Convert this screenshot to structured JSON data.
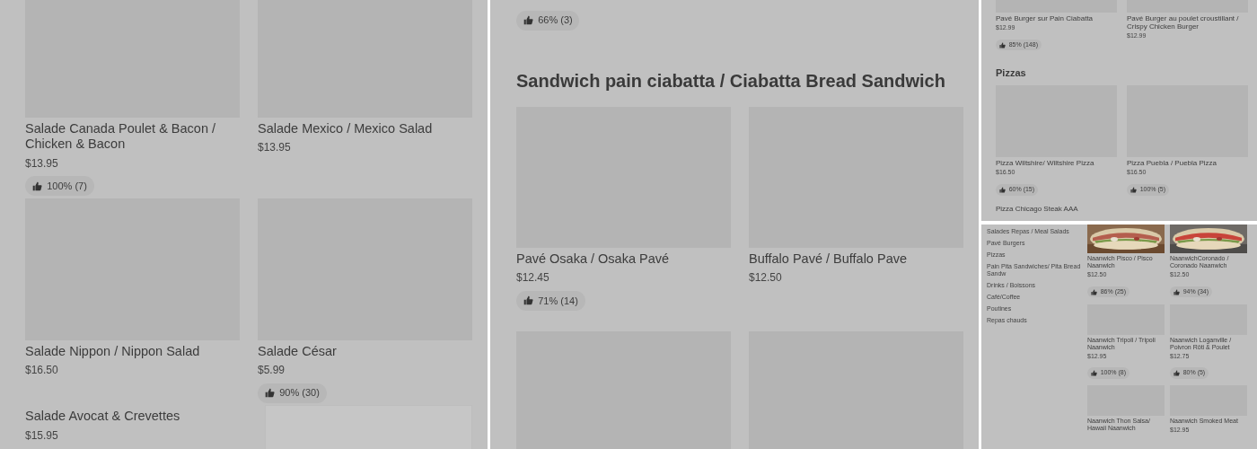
{
  "panels": [
    {
      "kind": "menu",
      "sections": [
        {
          "items": [
            {
              "name": "Salade Canada Poulet & Bacon / Chicken & Bacon",
              "price": "$13.95",
              "rating": "100% (7)",
              "kind": "placeholder"
            },
            {
              "name": "Salade Mexico / Mexico Salad",
              "price": "$13.95",
              "kind": "placeholder"
            },
            {
              "name": "Salade Nippon / Nippon Salad",
              "price": "$16.50",
              "kind": "placeholder"
            },
            {
              "name": "Salade César",
              "price": "$5.99",
              "rating": "90% (30)",
              "kind": "placeholder"
            },
            {
              "name": "Salade Avocat & Crevettes",
              "price": "$15.95"
            },
            {
              "kind": "blank"
            }
          ]
        }
      ]
    },
    {
      "kind": "menu",
      "sections": [
        {
          "items": [
            {
              "rating": "66% (3)"
            }
          ]
        },
        {
          "heading": "Sandwich pain ciabatta / Ciabatta Bread Sandwich",
          "items": [
            {
              "name": "Pavé Osaka / Osaka Pavé",
              "price": "$12.45",
              "rating": "71% (14)",
              "kind": "placeholder"
            },
            {
              "name": "Buffalo Pavé / Buffalo Pave",
              "price": "$12.50",
              "kind": "placeholder"
            },
            {
              "kind": "placeholder"
            },
            {
              "kind": "placeholder"
            }
          ]
        }
      ]
    },
    {
      "kind": "menu",
      "sections": [
        {
          "items": [
            {
              "name": "Pavé Burger sur Pain Ciabatta",
              "price": "$12.99",
              "rating": "85% (148)",
              "kind": "placeholder"
            },
            {
              "name": "Pavé Burger au poulet croustillant / Crispy Chicken Burger",
              "price": "$12.99",
              "kind": "placeholder"
            }
          ]
        },
        {
          "heading": "Pizzas",
          "items": [
            {
              "name": "Pizza Wiltshire/ Wiltshire Pizza",
              "price": "$16.50",
              "rating": "60% (15)",
              "kind": "placeholder"
            },
            {
              "name": "Pizza Puebla / Puebla Pizza",
              "price": "$16.50",
              "rating": "100% (5)",
              "kind": "placeholder"
            },
            {
              "name": "Pizza Chicago Steak AAA"
            }
          ]
        }
      ]
    },
    {
      "kind": "sidebar-menu",
      "sidebar": {
        "items": [
          "Salades Repas / Meal Salads",
          "Pavé Burgers",
          "Pizzas",
          "Pain Pita Sandwiches/ Pita Bread Sandw",
          "Drinks / Boissons",
          "Café/Coffee",
          "Poutines",
          "Repas chauds"
        ]
      },
      "sections": [
        {
          "items": [
            {
              "name": "Naanwich Pisco / Pisco Naanwich",
              "price": "$12.50",
              "rating": "86% (25)"
            },
            {
              "name": "NaanwichCoronado / Coronado Naanwich",
              "price": "$12.50",
              "rating": "94% (34)"
            },
            {
              "name": "Naanwich Tripoli / Tripoli Naanwich",
              "price": "$12.95",
              "rating": "100% (8)",
              "kind": "placeholder"
            },
            {
              "name": "Naanwich Loganville / Poivron Rôti & Poulet",
              "price": "$12.75",
              "rating": "80% (5)",
              "kind": "placeholder"
            },
            {
              "name": "Naanwich Thon Salsa/ Hawaii Naanwich",
              "kind": "placeholder"
            },
            {
              "name": "Naanwich Smoked Meat",
              "price": "$12.95",
              "kind": "placeholder"
            }
          ]
        }
      ]
    }
  ]
}
